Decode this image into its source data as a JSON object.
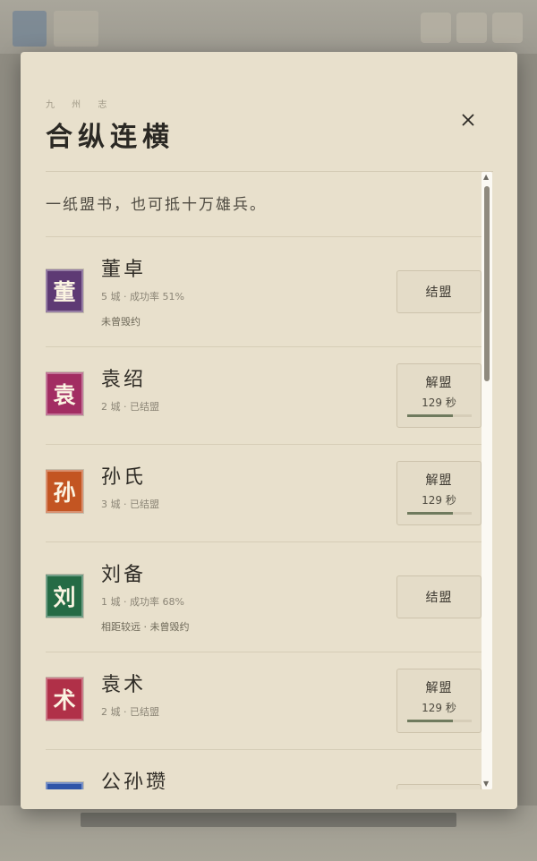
{
  "modal": {
    "kicker": "九 州 志",
    "title": "合纵连横",
    "motto": "一纸盟书，也可抵十万雄兵。"
  },
  "factions": [
    {
      "name": "董卓",
      "emblem": "董",
      "color": "#5e3a74",
      "stat": "5 城 · 成功率 51%",
      "note": "未曾毁约",
      "action": "结盟"
    },
    {
      "name": "袁绍",
      "emblem": "袁",
      "color": "#a22d62",
      "stat": "2 城 · 已结盟",
      "action": "解盟",
      "timer": "129 秒",
      "progress": 0.72
    },
    {
      "name": "孙氏",
      "emblem": "孙",
      "color": "#c35522",
      "stat": "3 城 · 已结盟",
      "action": "解盟",
      "timer": "129 秒",
      "progress": 0.72
    },
    {
      "name": "刘备",
      "emblem": "刘",
      "color": "#256b45",
      "stat": "1 城 · 成功率 68%",
      "note": "相距较远 · 未曾毁约",
      "action": "结盟"
    },
    {
      "name": "袁术",
      "emblem": "术",
      "color": "#b03048",
      "stat": "2 城 · 已结盟",
      "action": "解盟",
      "timer": "129 秒",
      "progress": 0.72
    },
    {
      "name": "公孙瓒",
      "emblem": "",
      "color": "#2f55a8",
      "stat": "",
      "action": ""
    }
  ]
}
